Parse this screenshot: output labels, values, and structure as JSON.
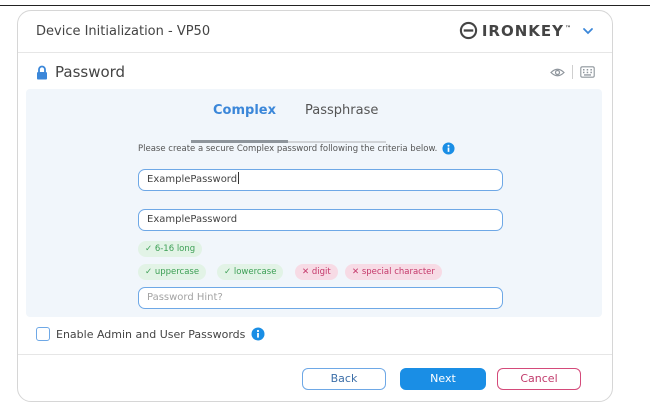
{
  "window": {
    "title": "Device Initialization - VP50"
  },
  "brand": {
    "name": "IRONKEY",
    "trademark": "™",
    "logo_icon": "ironkey-logo-icon",
    "accent": "#1a8ee5"
  },
  "section": {
    "title": "Password",
    "icon": "lock-icon"
  },
  "toolbar": {
    "show_password_icon": "eye-icon",
    "keyboard_icon": "keyboard-icon"
  },
  "tabs": [
    {
      "label": "Complex",
      "active": true
    },
    {
      "label": "Passphrase",
      "active": false
    }
  ],
  "instructions": "Please create a secure Complex password following the criteria below.",
  "password": {
    "value": "ExamplePassword"
  },
  "confirm_password": {
    "value": "ExamplePassword"
  },
  "criteria": [
    {
      "label": "6-16 long",
      "met": true
    },
    {
      "label": "uppercase",
      "met": true
    },
    {
      "label": "lowercase",
      "met": true
    },
    {
      "label": "digit",
      "met": false
    },
    {
      "label": "special character",
      "met": false
    }
  ],
  "hint": {
    "placeholder": "Password Hint?"
  },
  "admin_option": {
    "label": "Enable Admin and User Passwords",
    "checked": false
  },
  "buttons": {
    "back": "Back",
    "next": "Next",
    "cancel": "Cancel"
  },
  "colors": {
    "ok": "#3c9f55",
    "bad": "#c4386a",
    "primary": "#1a8ee5"
  }
}
